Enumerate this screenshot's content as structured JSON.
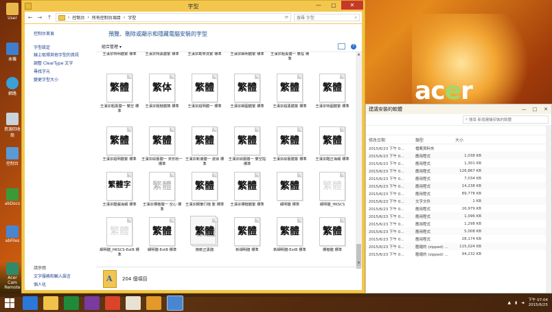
{
  "desktop": {
    "icons": [
      "User",
      "本機",
      "網路",
      "資源回收筒",
      "控制台",
      "abDocs",
      "abFiles",
      "Acer Cam Remote"
    ],
    "wallpaper_brand": "acer"
  },
  "main_window": {
    "title": "字型",
    "breadcrumbs": [
      "控制台",
      "所有控制台項目",
      "字型"
    ],
    "search_placeholder": "搜尋 字型",
    "sidebar": {
      "home": "控制台首頁",
      "links": [
        "字型設定",
        "線上取得其他字型的資訊",
        "調整 ClearType 文字",
        "尋找字元",
        "變更字型大小"
      ],
      "see_also_title": "請參閱",
      "see_also": [
        "文字服務和輸入語言",
        "個人化"
      ]
    },
    "headline": "預覽、刪除或顯示和隱藏電腦安裝的字型",
    "organize": "組合管理",
    "help": "?",
    "row0_labels": [
      "王漢宗特明體繁 標準",
      "王漢宗特黑體繁 標準",
      "王漢宗勘亭流繁 標準",
      "王漢宗細明體繁 標準",
      "王漢宗粗黑體一 雙陰 標準"
    ],
    "fonts": [
      {
        "glyph": "繁體",
        "label": "王漢宗粗黑體一 雙空 標準"
      },
      {
        "glyph": "繁体",
        "label": "王漢宗粗楷體簡 標準"
      },
      {
        "glyph": "繁體",
        "label": "王漢宗超明體一 標準"
      },
      {
        "glyph": "繁體",
        "label": "王漢宗細圓體繁 標準"
      },
      {
        "glyph": "繁體",
        "label": "王漢宗超黑體繁 標準"
      },
      {
        "glyph": "繁體",
        "label": "王漢宗特圓體繁 標準"
      },
      {
        "glyph": "繁體",
        "label": "王漢宗超明體繁 標準"
      },
      {
        "glyph": "繁體",
        "label": "王漢宗綜藝體一 夾形粉一 標準"
      },
      {
        "glyph": "繁體",
        "label": "王漢宗新潮體一 波浪 標準"
      },
      {
        "glyph": "繁體",
        "label": "王漢宗綜藝體一 雙空陰 標準"
      },
      {
        "glyph": "繁體",
        "label": "王漢宗綜藝體繁 標準"
      },
      {
        "glyph": "繁體",
        "label": "王漢宗酷正海報 標準"
      },
      {
        "glyph": "繁體字",
        "label": "王漢宗酷儷海報 標準"
      },
      {
        "glyph": "繁體",
        "label": "王漢宗標楷體一 空心 標準"
      },
      {
        "glyph": "繁體",
        "label": "王漢宗鋼筆行楷 繁 標準"
      },
      {
        "glyph": "繁體",
        "label": "王漢宗標楷體繁 標準"
      },
      {
        "glyph": "繁體",
        "label": "細明體 標準"
      },
      {
        "glyph": "繁體",
        "label": "細明體_HKSCS"
      },
      {
        "glyph": "繁體",
        "label": "細明體_HKSCS-ExtB 標準"
      },
      {
        "glyph": "繁體",
        "label": "細明體-ExtB 標準"
      },
      {
        "glyph": "繁體",
        "label": "微軟正黑體"
      },
      {
        "glyph": "繁體",
        "label": "新細明體 標準"
      },
      {
        "glyph": "繁體",
        "label": "新細明體-ExtB 標準"
      },
      {
        "glyph": "繁體",
        "label": "標楷體 標準"
      }
    ],
    "item_count": "204 個項目"
  },
  "second_window": {
    "title": "建議安裝的軟體",
    "search_placeholder": "搜尋 新增建議安裝的軟體",
    "columns": [
      "修改日期",
      "類型",
      "大小"
    ],
    "rows": [
      {
        "date": "2015/6/23 下午 0...",
        "type": "檔案資料夾",
        "size": ""
      },
      {
        "date": "2015/6/23 下午 0...",
        "type": "應用程式",
        "size": "1,038 KB"
      },
      {
        "date": "2015/6/23 下午 0...",
        "type": "應用程式",
        "size": "1,301 KB"
      },
      {
        "date": "2015/6/23 下午 0...",
        "type": "應用程式",
        "size": "126,867 KB"
      },
      {
        "date": "2015/6/23 下午 0...",
        "type": "應用程式",
        "size": "7,034 KB"
      },
      {
        "date": "2015/6/23 下午 0...",
        "type": "應用程式",
        "size": "14,238 KB"
      },
      {
        "date": "2015/6/23 下午 0...",
        "type": "應用程式",
        "size": "89,778 KB"
      },
      {
        "date": "2015/6/23 下午 0...",
        "type": "文字文件",
        "size": "1 KB"
      },
      {
        "date": "2015/6/23 下午 0...",
        "type": "應用程式",
        "size": "16,979 KB"
      },
      {
        "date": "2015/6/23 下午 0...",
        "type": "應用程式",
        "size": "1,096 KB"
      },
      {
        "date": "2015/6/23 下午 0...",
        "type": "應用程式",
        "size": "1,298 KB"
      },
      {
        "date": "2015/6/23 下午 0...",
        "type": "應用程式",
        "size": "5,008 KB"
      },
      {
        "date": "2015/6/23 下午 0...",
        "type": "應用程式",
        "size": "28,174 KB"
      },
      {
        "date": "2015/6/23 下午 0...",
        "type": "壓縮的 (zipped) ...",
        "size": "115,024 KB"
      },
      {
        "date": "2015/6/23 下午 0...",
        "type": "壓縮的 (zipped) ...",
        "size": "94,232 KB"
      }
    ]
  },
  "taskbar": {
    "apps": [
      "ie-icon",
      "file-explorer-icon",
      "excel-icon",
      "onenote-icon",
      "photo-icon",
      "home-icon",
      "app-icon",
      "control-panel-icon"
    ],
    "clock_time": "下午 07:04",
    "clock_date": "2015/6/23"
  },
  "colors": {
    "window_frame": "#f3c74e",
    "link": "#1a3c8c",
    "close": "#c7382a"
  }
}
